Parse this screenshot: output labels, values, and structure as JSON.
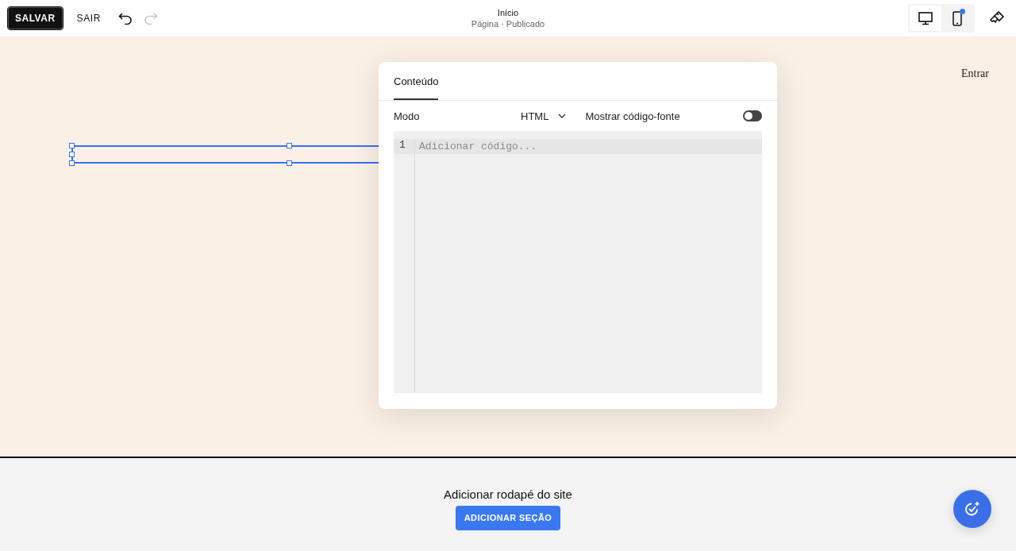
{
  "toolbar": {
    "save": "SALVAR",
    "exit": "SAIR",
    "undo_disabled": false,
    "redo_disabled": true
  },
  "page": {
    "title": "Início",
    "subtitle": "Página · Publicado"
  },
  "devices": [
    {
      "kind": "desktop",
      "selected": true,
      "badge": false
    },
    {
      "kind": "mobile",
      "selected": false,
      "badge": true
    }
  ],
  "site": {
    "login": "Entrar"
  },
  "panel": {
    "tabs": [
      {
        "label": "Conteúdo",
        "selected": true
      }
    ],
    "mode_label": "Modo",
    "mode_value": "HTML",
    "source_label": "Mostrar código-fonte",
    "source_on": false,
    "editor": {
      "line_numbers": [
        "1"
      ],
      "placeholder": "Adicionar código..."
    }
  },
  "footer": {
    "title": "Adicionar rodapé do site",
    "button": "ADICIONAR SEÇÃO"
  }
}
